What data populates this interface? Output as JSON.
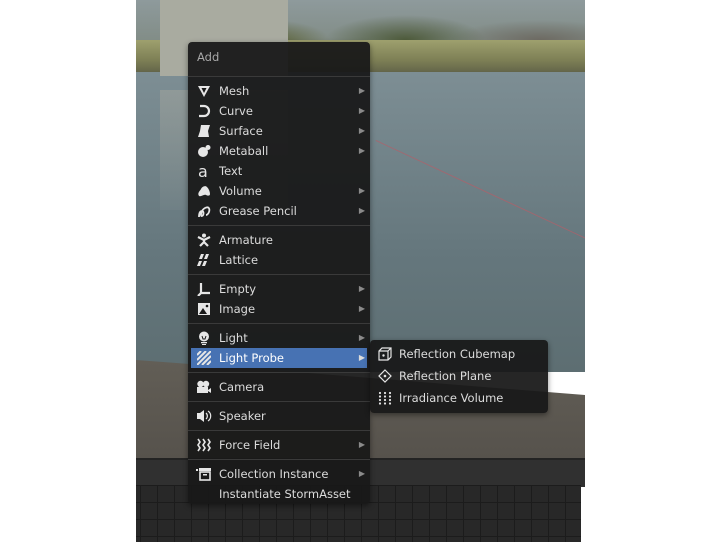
{
  "menu": {
    "title": "Add",
    "groups": [
      [
        {
          "label": "Mesh",
          "icon": "mesh-icon",
          "submenu": true
        },
        {
          "label": "Curve",
          "icon": "curve-icon",
          "submenu": true
        },
        {
          "label": "Surface",
          "icon": "surface-icon",
          "submenu": true
        },
        {
          "label": "Metaball",
          "icon": "metaball-icon",
          "submenu": true
        },
        {
          "label": "Text",
          "icon": "text-icon",
          "submenu": false
        },
        {
          "label": "Volume",
          "icon": "volume-icon",
          "submenu": true
        },
        {
          "label": "Grease Pencil",
          "icon": "grease-pencil-icon",
          "submenu": true
        }
      ],
      [
        {
          "label": "Armature",
          "icon": "armature-icon",
          "submenu": false
        },
        {
          "label": "Lattice",
          "icon": "lattice-icon",
          "submenu": false
        }
      ],
      [
        {
          "label": "Empty",
          "icon": "empty-icon",
          "submenu": true
        },
        {
          "label": "Image",
          "icon": "image-icon",
          "submenu": true
        }
      ],
      [
        {
          "label": "Light",
          "icon": "light-icon",
          "submenu": true
        },
        {
          "label": "Light Probe",
          "icon": "light-probe-icon",
          "submenu": true,
          "active": true
        }
      ],
      [
        {
          "label": "Camera",
          "icon": "camera-icon",
          "submenu": false
        }
      ],
      [
        {
          "label": "Speaker",
          "icon": "speaker-icon",
          "submenu": false
        }
      ],
      [
        {
          "label": "Force Field",
          "icon": "force-field-icon",
          "submenu": true
        }
      ],
      [
        {
          "label": "Collection Instance",
          "icon": "collection-instance-icon",
          "submenu": true
        },
        {
          "label": "Instantiate StormAsset",
          "icon": "",
          "submenu": false
        }
      ]
    ]
  },
  "submenu": {
    "parent": "Light Probe",
    "items": [
      {
        "label": "Reflection Cubemap",
        "icon": "reflection-cubemap-icon"
      },
      {
        "label": "Reflection Plane",
        "icon": "reflection-plane-icon"
      },
      {
        "label": "Irradiance Volume",
        "icon": "irradiance-volume-icon"
      }
    ]
  },
  "colors": {
    "menu_bg": "#181818",
    "highlight": "#4772b3",
    "text": "#dcdcdc",
    "title_text": "#a8a8a8"
  }
}
